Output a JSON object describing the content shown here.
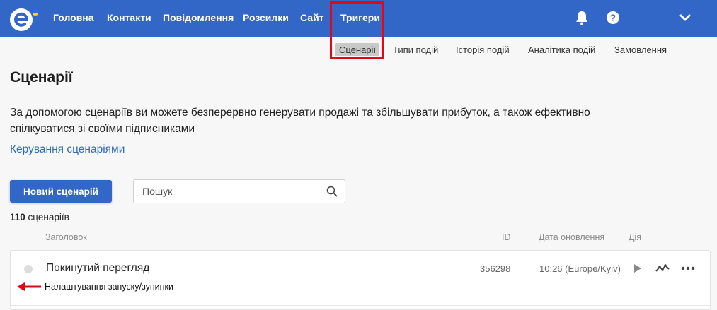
{
  "colors": {
    "brand": "#3267c8",
    "link": "#2c6bc4",
    "highlight": "#e30613"
  },
  "nav": {
    "items": [
      "Головна",
      "Контакти",
      "Повідомлення",
      "Розсилки",
      "Сайт",
      "Тригери"
    ],
    "icons": [
      "bell-icon",
      "help-icon",
      "chevron-down-icon"
    ]
  },
  "subnav": {
    "items": [
      "Сценарії",
      "Типи подій",
      "Історія подій",
      "Аналітика подій",
      "Замовлення"
    ],
    "active": "Сценарії"
  },
  "page": {
    "title": "Сценарії",
    "description": "За допомогою сценаріїв ви можете безперервно генерувати продажі та збільшувати прибуток, а також ефективно спілкуватися зі своїми підписниками",
    "manage_link": "Керування сценаріями"
  },
  "toolbar": {
    "new_button": "Новий сценарій",
    "search_placeholder": "Пошук",
    "search_value": ""
  },
  "list": {
    "count": "110",
    "count_label": "сценаріїв",
    "columns": {
      "title": "Заголовок",
      "id": "ID",
      "updated": "Дата оновлення",
      "action": "Дія"
    },
    "rows": [
      {
        "title": "Покинутий перегляд",
        "id": "356298",
        "updated": "10:26 (Europe/Kyiv)"
      }
    ]
  },
  "annotation": {
    "text": "Налаштування запуску/зупинки"
  }
}
